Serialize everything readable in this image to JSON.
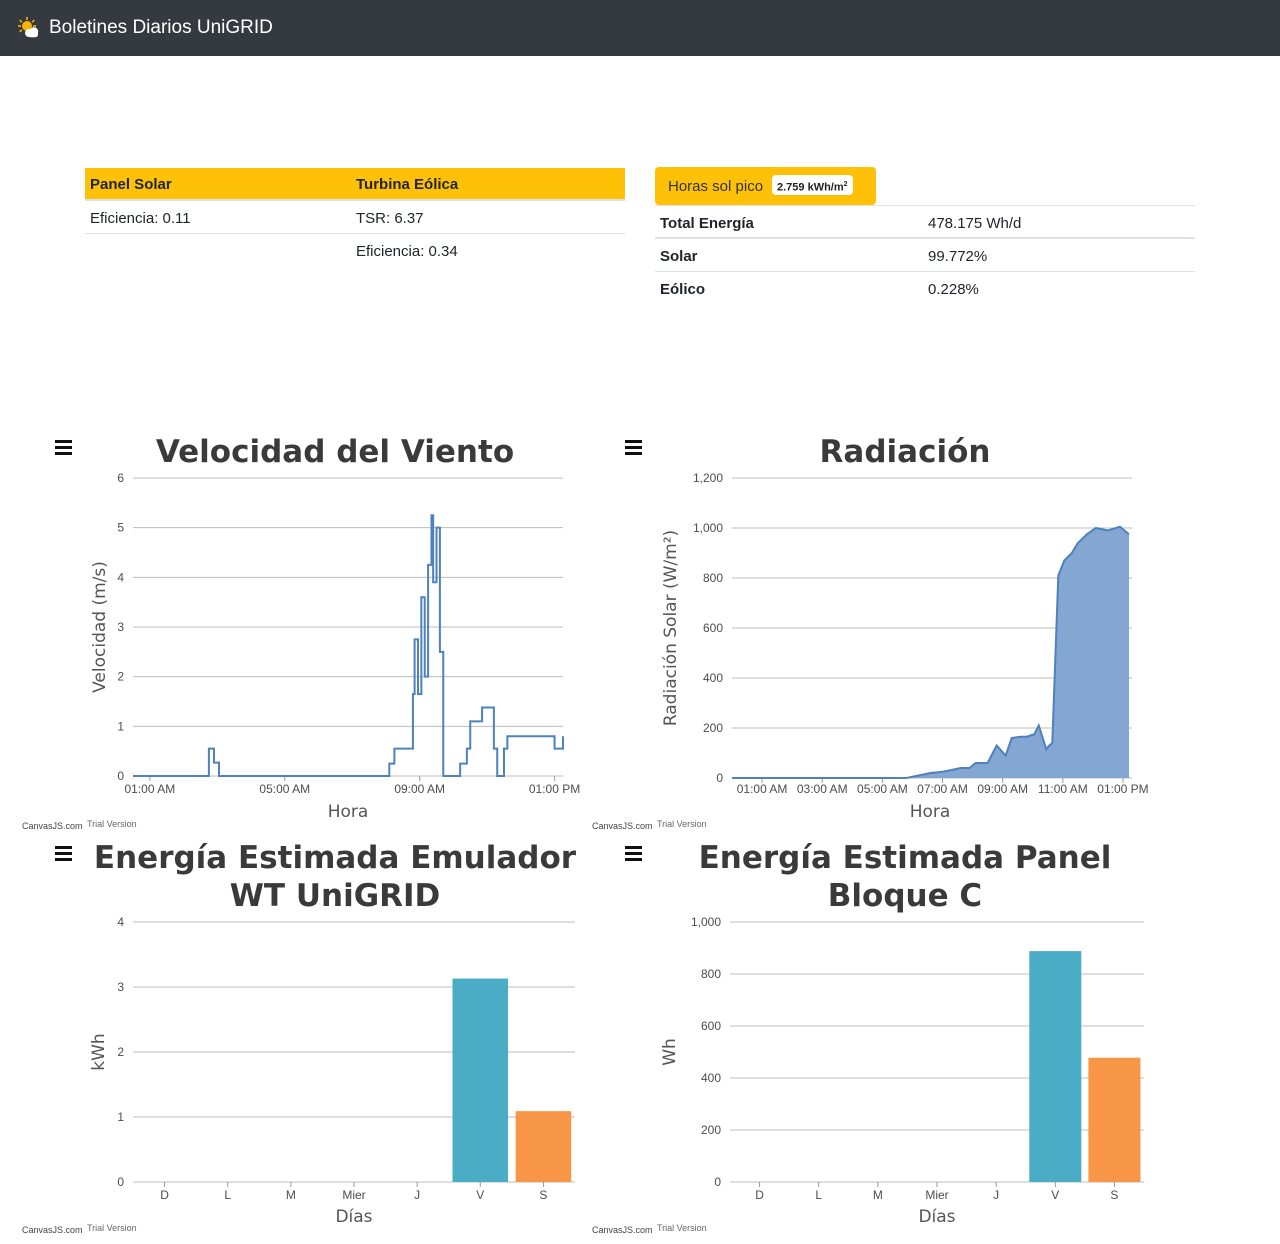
{
  "navbar": {
    "title": "Boletines Diarios UniGRID",
    "logo_icon": "sun-cloud-icon"
  },
  "config_table": {
    "headers": [
      "Panel Solar",
      "Turbina Eólica"
    ],
    "rows": [
      [
        "Eficiencia: 0.11",
        "TSR: 6.37"
      ],
      [
        "",
        "Eficiencia: 0.34"
      ]
    ]
  },
  "peak_hours": {
    "label": "Horas sol pico",
    "value": "2.759 kWh/m",
    "unit_sup": "2"
  },
  "energy_table": {
    "rows": [
      [
        "Total Energía",
        "478.175 Wh/d"
      ],
      [
        "Solar",
        "99.772%"
      ],
      [
        "Eólico",
        "0.228%"
      ]
    ]
  },
  "menu_icon": "hamburger-menu-icon",
  "credits": {
    "brand": "CanvasJS.com",
    "trial": "Trial Version"
  },
  "colors": {
    "navbar": "#343a40",
    "accent": "#ffc107",
    "wind_line": "#4f81bc",
    "radiation_fill": "#83a6d3",
    "bar_blue": "#4aacc5",
    "bar_orange": "#f79647"
  },
  "chart_data": [
    {
      "id": "wind",
      "type": "line",
      "step": true,
      "title": "Velocidad del Viento",
      "xlabel": "Hora",
      "ylabel": "Velocidad (m/s)",
      "ylim": [
        0,
        6
      ],
      "yticks": [
        "0",
        "1",
        "2",
        "3",
        "4",
        "5",
        "6"
      ],
      "xlim": [
        0.5,
        13.25
      ],
      "xticks": [
        {
          "x": 1,
          "label": "01:00 AM"
        },
        {
          "x": 5,
          "label": "05:00 AM"
        },
        {
          "x": 9,
          "label": "09:00 AM"
        },
        {
          "x": 13,
          "label": "01:00 PM"
        }
      ],
      "x_unit": "hour of day",
      "series": [
        {
          "x": [
            0.5,
            2.75,
            2.9,
            3.05,
            3.3,
            8.1,
            8.25,
            8.65,
            8.8,
            8.85,
            8.95,
            9.05,
            9.15,
            9.25,
            9.35,
            9.4,
            9.5,
            9.6,
            9.7,
            10.05,
            10.2,
            10.4,
            10.5,
            10.85,
            11.0,
            11.2,
            11.3,
            11.5,
            11.6,
            12.0,
            12.05,
            12.3,
            12.35,
            13.0,
            13.1,
            13.25
          ],
          "y": [
            0,
            0.55,
            0.27,
            0,
            0,
            0.25,
            0.55,
            0.55,
            1.65,
            2.75,
            1.65,
            3.6,
            2.0,
            4.25,
            5.25,
            3.9,
            5.0,
            2.5,
            0,
            0,
            0.25,
            0.55,
            1.1,
            1.38,
            1.38,
            0.55,
            0,
            0.55,
            0.8,
            0.8,
            0.8,
            0.8,
            0.8,
            0.55,
            0.55,
            0.8
          ]
        }
      ]
    },
    {
      "id": "radiation",
      "type": "area",
      "title": "Radiación",
      "xlabel": "Hora",
      "ylabel": "Radiación Solar (W/m²)",
      "ylim": [
        0,
        1200
      ],
      "yticks": [
        "0",
        "200",
        "400",
        "600",
        "800",
        "1,000",
        "1,200"
      ],
      "xlim": [
        0.0,
        13.3
      ],
      "xticks": [
        {
          "x": 1,
          "label": "01:00 AM"
        },
        {
          "x": 3,
          "label": "03:00 AM"
        },
        {
          "x": 5,
          "label": "05:00 AM"
        },
        {
          "x": 7,
          "label": "07:00 AM"
        },
        {
          "x": 9,
          "label": "09:00 AM"
        },
        {
          "x": 11,
          "label": "11:00 AM"
        },
        {
          "x": 13,
          "label": "01:00 PM"
        }
      ],
      "x_unit": "hour of day",
      "series": [
        {
          "x": [
            0.0,
            5.8,
            6.2,
            6.6,
            7.0,
            7.3,
            7.6,
            7.9,
            8.1,
            8.5,
            8.8,
            9.1,
            9.3,
            9.6,
            9.8,
            10.05,
            10.2,
            10.45,
            10.55,
            10.65,
            10.85,
            11.05,
            11.3,
            11.5,
            11.8,
            12.1,
            12.5,
            12.9,
            13.2
          ],
          "y": [
            0,
            0,
            10,
            20,
            25,
            32,
            40,
            40,
            60,
            60,
            130,
            90,
            160,
            165,
            165,
            175,
            210,
            115,
            130,
            140,
            810,
            870,
            900,
            940,
            975,
            1000,
            990,
            1005,
            975
          ]
        }
      ]
    },
    {
      "id": "wt-energy",
      "type": "bar",
      "title": [
        "Energía Estimada Emulador",
        "WT UniGRID"
      ],
      "xlabel": "Días",
      "ylabel": "kWh",
      "ylim": [
        0,
        4
      ],
      "yticks": [
        "0",
        "1",
        "2",
        "3",
        "4"
      ],
      "categories": [
        "D",
        "L",
        "M",
        "Mier",
        "J",
        "V",
        "S"
      ],
      "values": [
        0,
        0,
        0,
        0,
        0,
        3.13,
        1.09
      ],
      "bar_colors": [
        "#4aacc5",
        "#4aacc5",
        "#4aacc5",
        "#4aacc5",
        "#4aacc5",
        "#4aacc5",
        "#f79647"
      ]
    },
    {
      "id": "panel-energy",
      "type": "bar",
      "title": [
        "Energía Estimada Panel",
        "Bloque C"
      ],
      "xlabel": "Días",
      "ylabel": "Wh",
      "ylim": [
        0,
        1000
      ],
      "yticks": [
        "0",
        "200",
        "400",
        "600",
        "800",
        "1,000"
      ],
      "categories": [
        "D",
        "L",
        "M",
        "Mier",
        "J",
        "V",
        "S"
      ],
      "values": [
        0,
        0,
        0,
        0,
        0,
        888,
        478
      ],
      "bar_colors": [
        "#4aacc5",
        "#4aacc5",
        "#4aacc5",
        "#4aacc5",
        "#4aacc5",
        "#4aacc5",
        "#f79647"
      ]
    }
  ]
}
